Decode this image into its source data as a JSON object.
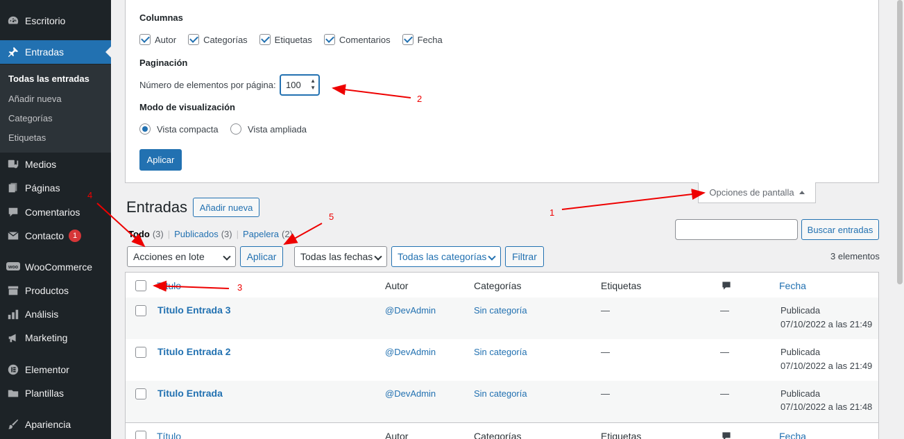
{
  "sidebar": {
    "items": [
      {
        "label": "Escritorio",
        "icon": "dashboard-icon"
      },
      {
        "label": "Entradas",
        "icon": "pin-icon"
      },
      {
        "label": "Medios",
        "icon": "media-icon"
      },
      {
        "label": "Páginas",
        "icon": "pages-icon"
      },
      {
        "label": "Comentarios",
        "icon": "comment-icon"
      },
      {
        "label": "Contacto",
        "icon": "mail-icon",
        "badge": "1"
      },
      {
        "label": "WooCommerce",
        "icon": "woo-icon"
      },
      {
        "label": "Productos",
        "icon": "archive-icon"
      },
      {
        "label": "Análisis",
        "icon": "chart-icon"
      },
      {
        "label": "Marketing",
        "icon": "megaphone-icon"
      },
      {
        "label": "Elementor",
        "icon": "elementor-icon"
      },
      {
        "label": "Plantillas",
        "icon": "folder-icon"
      },
      {
        "label": "Apariencia",
        "icon": "brush-icon"
      }
    ],
    "submenu": [
      "Todas las entradas",
      "Añadir nueva",
      "Categorías",
      "Etiquetas"
    ]
  },
  "screen_options": {
    "columns_heading": "Columnas",
    "columns": [
      {
        "label": "Autor",
        "checked": true
      },
      {
        "label": "Categorías",
        "checked": true
      },
      {
        "label": "Etiquetas",
        "checked": true
      },
      {
        "label": "Comentarios",
        "checked": true
      },
      {
        "label": "Fecha",
        "checked": true
      }
    ],
    "pagination_heading": "Paginación",
    "per_page_label": "Número de elementos por página:",
    "per_page_value": "100",
    "view_mode_heading": "Modo de visualización",
    "view_modes": [
      {
        "label": "Vista compacta",
        "checked": true
      },
      {
        "label": "Vista ampliada",
        "checked": false
      }
    ],
    "apply_label": "Aplicar",
    "tab_label": "Opciones de pantalla"
  },
  "page": {
    "title": "Entradas",
    "add_new": "Añadir nueva",
    "filters": {
      "all": "Todo",
      "all_count": "(3)",
      "published": "Publicados",
      "published_count": "(3)",
      "trash": "Papelera",
      "trash_count": "(2)",
      "separator": "|"
    },
    "search_button": "Buscar entradas",
    "bulk_actions": "Acciones en lote",
    "apply": "Aplicar",
    "all_dates": "Todas las fechas",
    "all_categories": "Todas las categorías",
    "filter": "Filtrar",
    "items_count": "3 elementos"
  },
  "table": {
    "headers": {
      "title": "Título",
      "author": "Autor",
      "categories": "Categorías",
      "tags": "Etiquetas",
      "date": "Fecha"
    },
    "rows": [
      {
        "title": "Titulo Entrada 3",
        "author": "@DevAdmin",
        "category": "Sin categoría",
        "tags": "—",
        "comments": "—",
        "status": "Publicada",
        "date": "07/10/2022 a las 21:49"
      },
      {
        "title": "Titulo Entrada 2",
        "author": "@DevAdmin",
        "category": "Sin categoría",
        "tags": "—",
        "comments": "—",
        "status": "Publicada",
        "date": "07/10/2022 a las 21:49"
      },
      {
        "title": "Titulo Entrada",
        "author": "@DevAdmin",
        "category": "Sin categoría",
        "tags": "—",
        "comments": "—",
        "status": "Publicada",
        "date": "07/10/2022 a las 21:48"
      }
    ]
  },
  "annotations": [
    "1",
    "2",
    "3",
    "4",
    "5"
  ],
  "colors": {
    "accent": "#2271b1",
    "sidebar": "#1d2327",
    "annotation": "#e00000"
  }
}
